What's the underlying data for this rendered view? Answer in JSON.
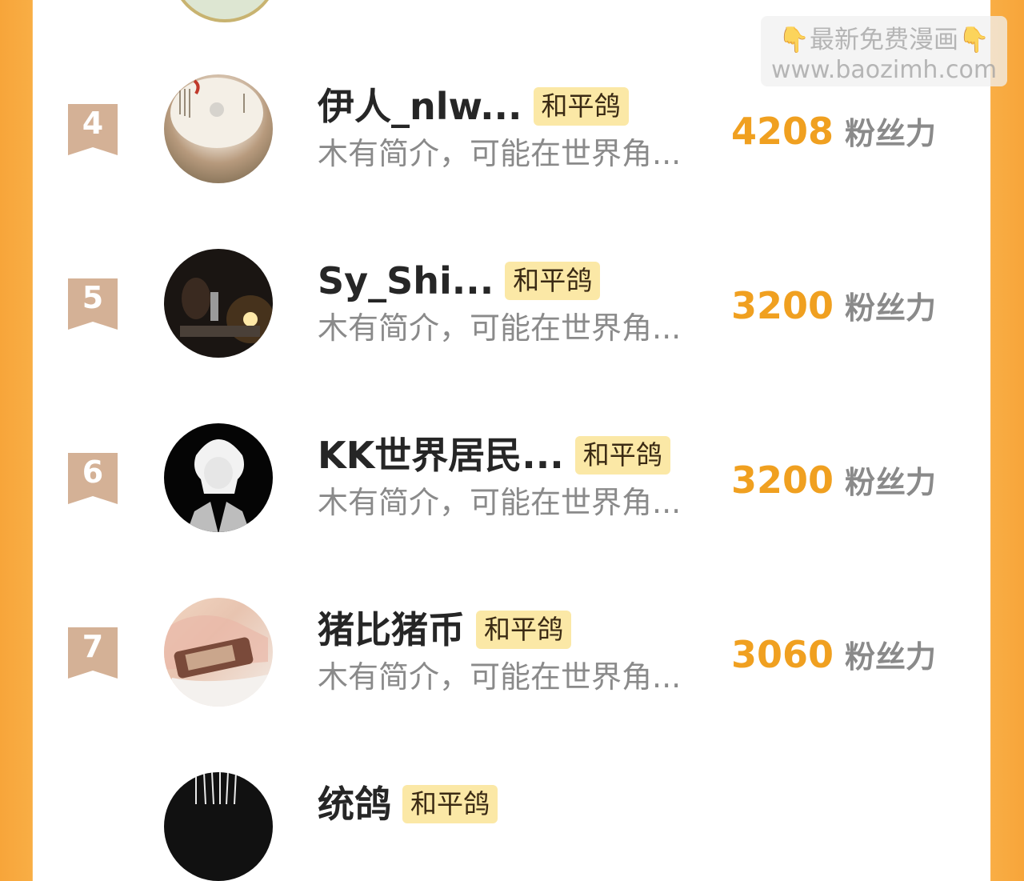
{
  "watermark": {
    "line1": "👇最新免费漫画👇",
    "line2": "www.baozimh.com"
  },
  "colors": {
    "accent": "#f0a020",
    "badge_bg": "#fbe8a6",
    "rank_ribbon": "#d4b196",
    "side_border": "#f9ae45"
  },
  "users": [
    {
      "rank": "4",
      "name": "伊人_nlw...",
      "badge": "和平鸽",
      "bio": "木有简介，可能在世界角...",
      "fans": "4208",
      "fans_unit": "粉丝力"
    },
    {
      "rank": "5",
      "name": "Sy_Shi...",
      "badge": "和平鸽",
      "bio": "木有简介，可能在世界角...",
      "fans": "3200",
      "fans_unit": "粉丝力"
    },
    {
      "rank": "6",
      "name": "KK世界居民...",
      "badge": "和平鸽",
      "bio": "木有简介，可能在世界角...",
      "fans": "3200",
      "fans_unit": "粉丝力"
    },
    {
      "rank": "7",
      "name": "猪比猪币",
      "badge": "和平鸽",
      "bio": "木有简介，可能在世界角...",
      "fans": "3060",
      "fans_unit": "粉丝力"
    },
    {
      "name": "统鸽",
      "badge": "和平鸽"
    }
  ]
}
